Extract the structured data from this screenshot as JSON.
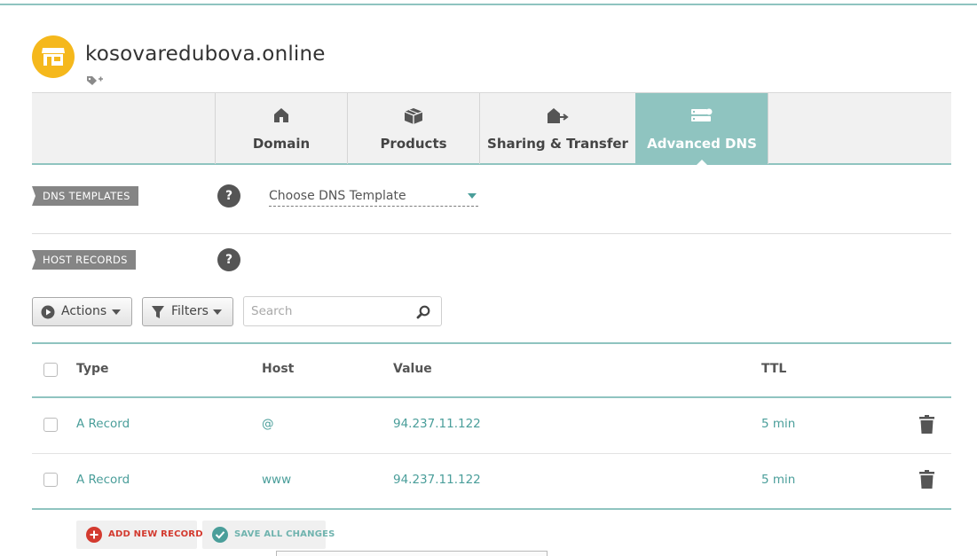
{
  "domain": {
    "name": "kosovaredubova.online"
  },
  "tabs": [
    {
      "label": "Domain",
      "icon": "home-icon"
    },
    {
      "label": "Products",
      "icon": "box-icon"
    },
    {
      "label": "Sharing & Transfer",
      "icon": "share-transfer-icon"
    },
    {
      "label": "Advanced DNS",
      "icon": "dns-server-icon",
      "active": true
    }
  ],
  "dns_templates": {
    "section_label": "DNS TEMPLATES",
    "help": "?",
    "select_value": "Choose DNS Template"
  },
  "host_records": {
    "section_label": "HOST RECORDS",
    "help": "?"
  },
  "toolbar": {
    "actions_label": "Actions",
    "filters_label": "Filters",
    "search_placeholder": "Search"
  },
  "table": {
    "columns": [
      "Type",
      "Host",
      "Value",
      "TTL"
    ],
    "rows": [
      {
        "type": "A Record",
        "host": "@",
        "value": "94.237.11.122",
        "ttl": "5 min"
      },
      {
        "type": "A Record",
        "host": "www",
        "value": "94.237.11.122",
        "ttl": "5 min"
      }
    ]
  },
  "footer": {
    "add_label": "ADD NEW RECORD",
    "save_label": "SAVE ALL CHANGES"
  },
  "colors": {
    "accent_teal": "#8fc4c0",
    "link_teal": "#4a9e9a",
    "logo_yellow": "#f5b81c",
    "add_red": "#d33a2f"
  }
}
